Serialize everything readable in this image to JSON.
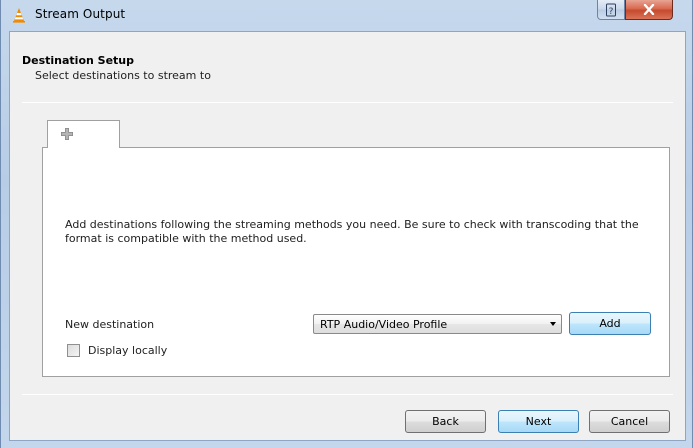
{
  "window": {
    "title": "Stream Output",
    "icons": {
      "app": "vlc-cone-icon",
      "help": "help-icon",
      "close": "close-icon"
    },
    "colors": {
      "close_button": "#c64a2d",
      "accent_button": "#bee6fd"
    }
  },
  "header": {
    "title": "Destination Setup",
    "subtitle": "Select destinations to stream to"
  },
  "tabs": [
    {
      "icon": "add-tab-icon",
      "label": ""
    }
  ],
  "pane": {
    "info": "Add destinations following the streaming methods you need. Be sure to check with transcoding that the format is compatible with the method used.",
    "new_destination_label": "New destination",
    "destination_select": {
      "selected": "RTP Audio/Video Profile"
    },
    "add_button": "Add",
    "display_locally": {
      "label": "Display locally",
      "checked": false
    }
  },
  "footer": {
    "back": "Back",
    "next": "Next",
    "cancel": "Cancel"
  }
}
